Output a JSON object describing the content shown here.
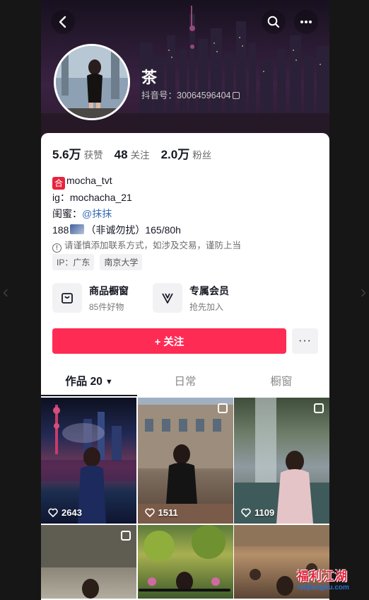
{
  "profile": {
    "nickname": "茶",
    "douyin_id": "抖音号：30064596404",
    "stats": [
      {
        "value": "5.6万",
        "label": "获赞"
      },
      {
        "value": "48",
        "label": "关注"
      },
      {
        "value": "2.0万",
        "label": "粉丝"
      }
    ],
    "bio": {
      "line1_tag": "合",
      "line1": "mocha_tvt",
      "line2": "ig：mochacha_21",
      "line3_prefix": "闺蜜：",
      "line3_mention": "@抹抹",
      "line4_prefix": "188",
      "line4_suffix": "（非诚勿扰）165/80h",
      "warning": "请谨慎添加联系方式，如涉及交易，谨防上当"
    },
    "tags": [
      "IP：广东",
      "南京大学"
    ],
    "features": [
      {
        "title": "商品橱窗",
        "subtitle": "85件好物",
        "icon": "bag-icon"
      },
      {
        "title": "专属会员",
        "subtitle": "抢先加入",
        "icon": "v-badge-icon"
      }
    ],
    "follow_label": "+ 关注",
    "more_label": "···"
  },
  "tabs": [
    {
      "label": "作品 20",
      "active": true
    },
    {
      "label": "日常",
      "active": false
    },
    {
      "label": "橱窗",
      "active": false
    }
  ],
  "videos": [
    {
      "likes": "2643",
      "multi": false
    },
    {
      "likes": "1511",
      "multi": true
    },
    {
      "likes": "1109",
      "multi": true
    },
    {
      "likes": "",
      "multi": true
    },
    {
      "likes": "",
      "multi": false
    },
    {
      "likes": "",
      "multi": false
    }
  ],
  "watermark": {
    "title": "福利江湖",
    "url": "fulijianghu.com"
  },
  "colors": {
    "accent": "#fe2c55",
    "mention": "#3b6fb6"
  }
}
